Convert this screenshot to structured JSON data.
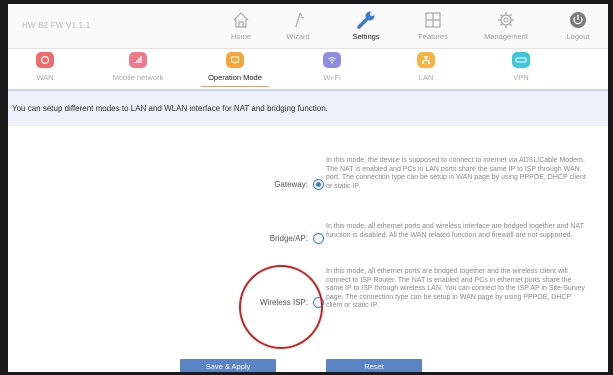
{
  "header": {
    "firmware": "HW B2 FW V1.1.1",
    "nav": [
      {
        "label": "Home",
        "icon": "home-icon"
      },
      {
        "label": "Wizard",
        "icon": "wand-icon"
      },
      {
        "label": "Settings",
        "icon": "wrench-icon",
        "active": true
      },
      {
        "label": "Features",
        "icon": "grid-icon"
      },
      {
        "label": "Management",
        "icon": "gear-icon"
      },
      {
        "label": "Logout",
        "icon": "logout-icon"
      }
    ]
  },
  "subnav": [
    {
      "label": "WAN",
      "color": "#ef6b6b"
    },
    {
      "label": "Mobile network",
      "color": "#ef7a8a"
    },
    {
      "label": "Operation Mode",
      "color": "#f5a63a",
      "active": true
    },
    {
      "label": "Wi-Fi",
      "color": "#8c8ce0"
    },
    {
      "label": "LAN",
      "color": "#f5b445"
    },
    {
      "label": "VPN",
      "color": "#3fc7d8"
    }
  ],
  "intro": "You can setup different modes to LAN and WLAN interface for NAT and bridging function.",
  "modes": [
    {
      "label": "Gateway:",
      "selected": true,
      "description": "In this mode, the device is supposed to connect to internet via ADSL/Cable Modem. The NAT is enabled and PCs in LAN ports share the same IP to ISP through WAN port. The connection type can be setup in WAN page by using PPPOE, DHCP client or static IP."
    },
    {
      "label": "Bridge/AP:",
      "selected": false,
      "description": "In this mode, all ethernet ports and wireless interface are bridged together and NAT function is disabled. All the WAN related function and firewall are not supported."
    },
    {
      "label": "Wireless ISP:",
      "selected": false,
      "description": "In this mode, all ethernet ports are bridged together and the wireless client will connect to ISP Router. The NAT is enabled and PCs in ethernet ports share the same IP to ISP through wireless LAN. You can connect to the ISP AP in Site-Survey page. The connection type can be setup in WAN page by using PPPOE, DHCP client or static IP."
    }
  ],
  "buttons": {
    "save": "Save & Apply",
    "reset": "Reset"
  }
}
